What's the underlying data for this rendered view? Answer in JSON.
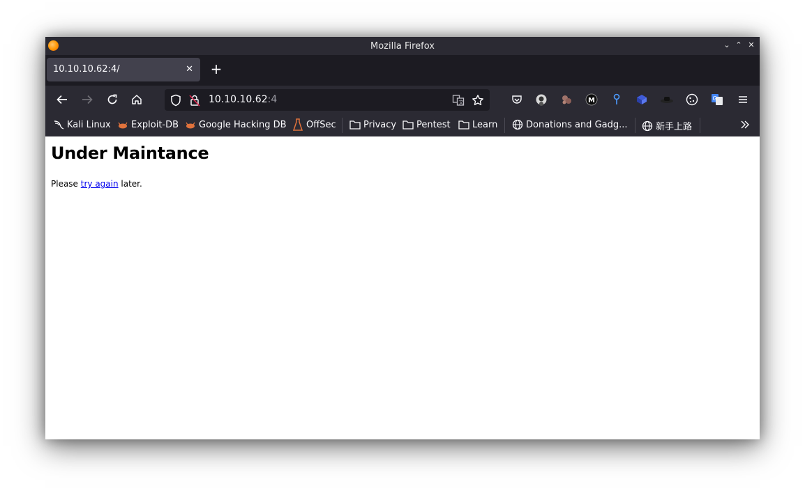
{
  "window": {
    "title": "Mozilla Firefox"
  },
  "tabs": [
    {
      "label": "10.10.10.62:4/"
    }
  ],
  "urlbar": {
    "host": "10.10.10.62",
    "port": ":4"
  },
  "bookmarks": [
    {
      "label": "Kali Linux",
      "icon": "kali-dragon-icon"
    },
    {
      "label": "Exploit-DB",
      "icon": "exploit-db-icon"
    },
    {
      "label": "Google Hacking DB",
      "icon": "exploit-db-icon"
    },
    {
      "label": "OffSec",
      "icon": "offsec-icon"
    },
    {
      "label": "Privacy",
      "icon": "folder-icon"
    },
    {
      "label": "Pentest",
      "icon": "folder-icon"
    },
    {
      "label": "Learn",
      "icon": "folder-icon"
    },
    {
      "label": "Donations and Gadg...",
      "icon": "globe-icon"
    },
    {
      "label": "新手上路",
      "icon": "globe-icon"
    }
  ],
  "page": {
    "heading": "Under Maintance",
    "text_before": "Please ",
    "link_text": "try again",
    "text_after": " later."
  },
  "colors": {
    "chrome_bg": "#2b2a33",
    "tabstrip_bg": "#1c1b22",
    "link": "#0000ee"
  }
}
